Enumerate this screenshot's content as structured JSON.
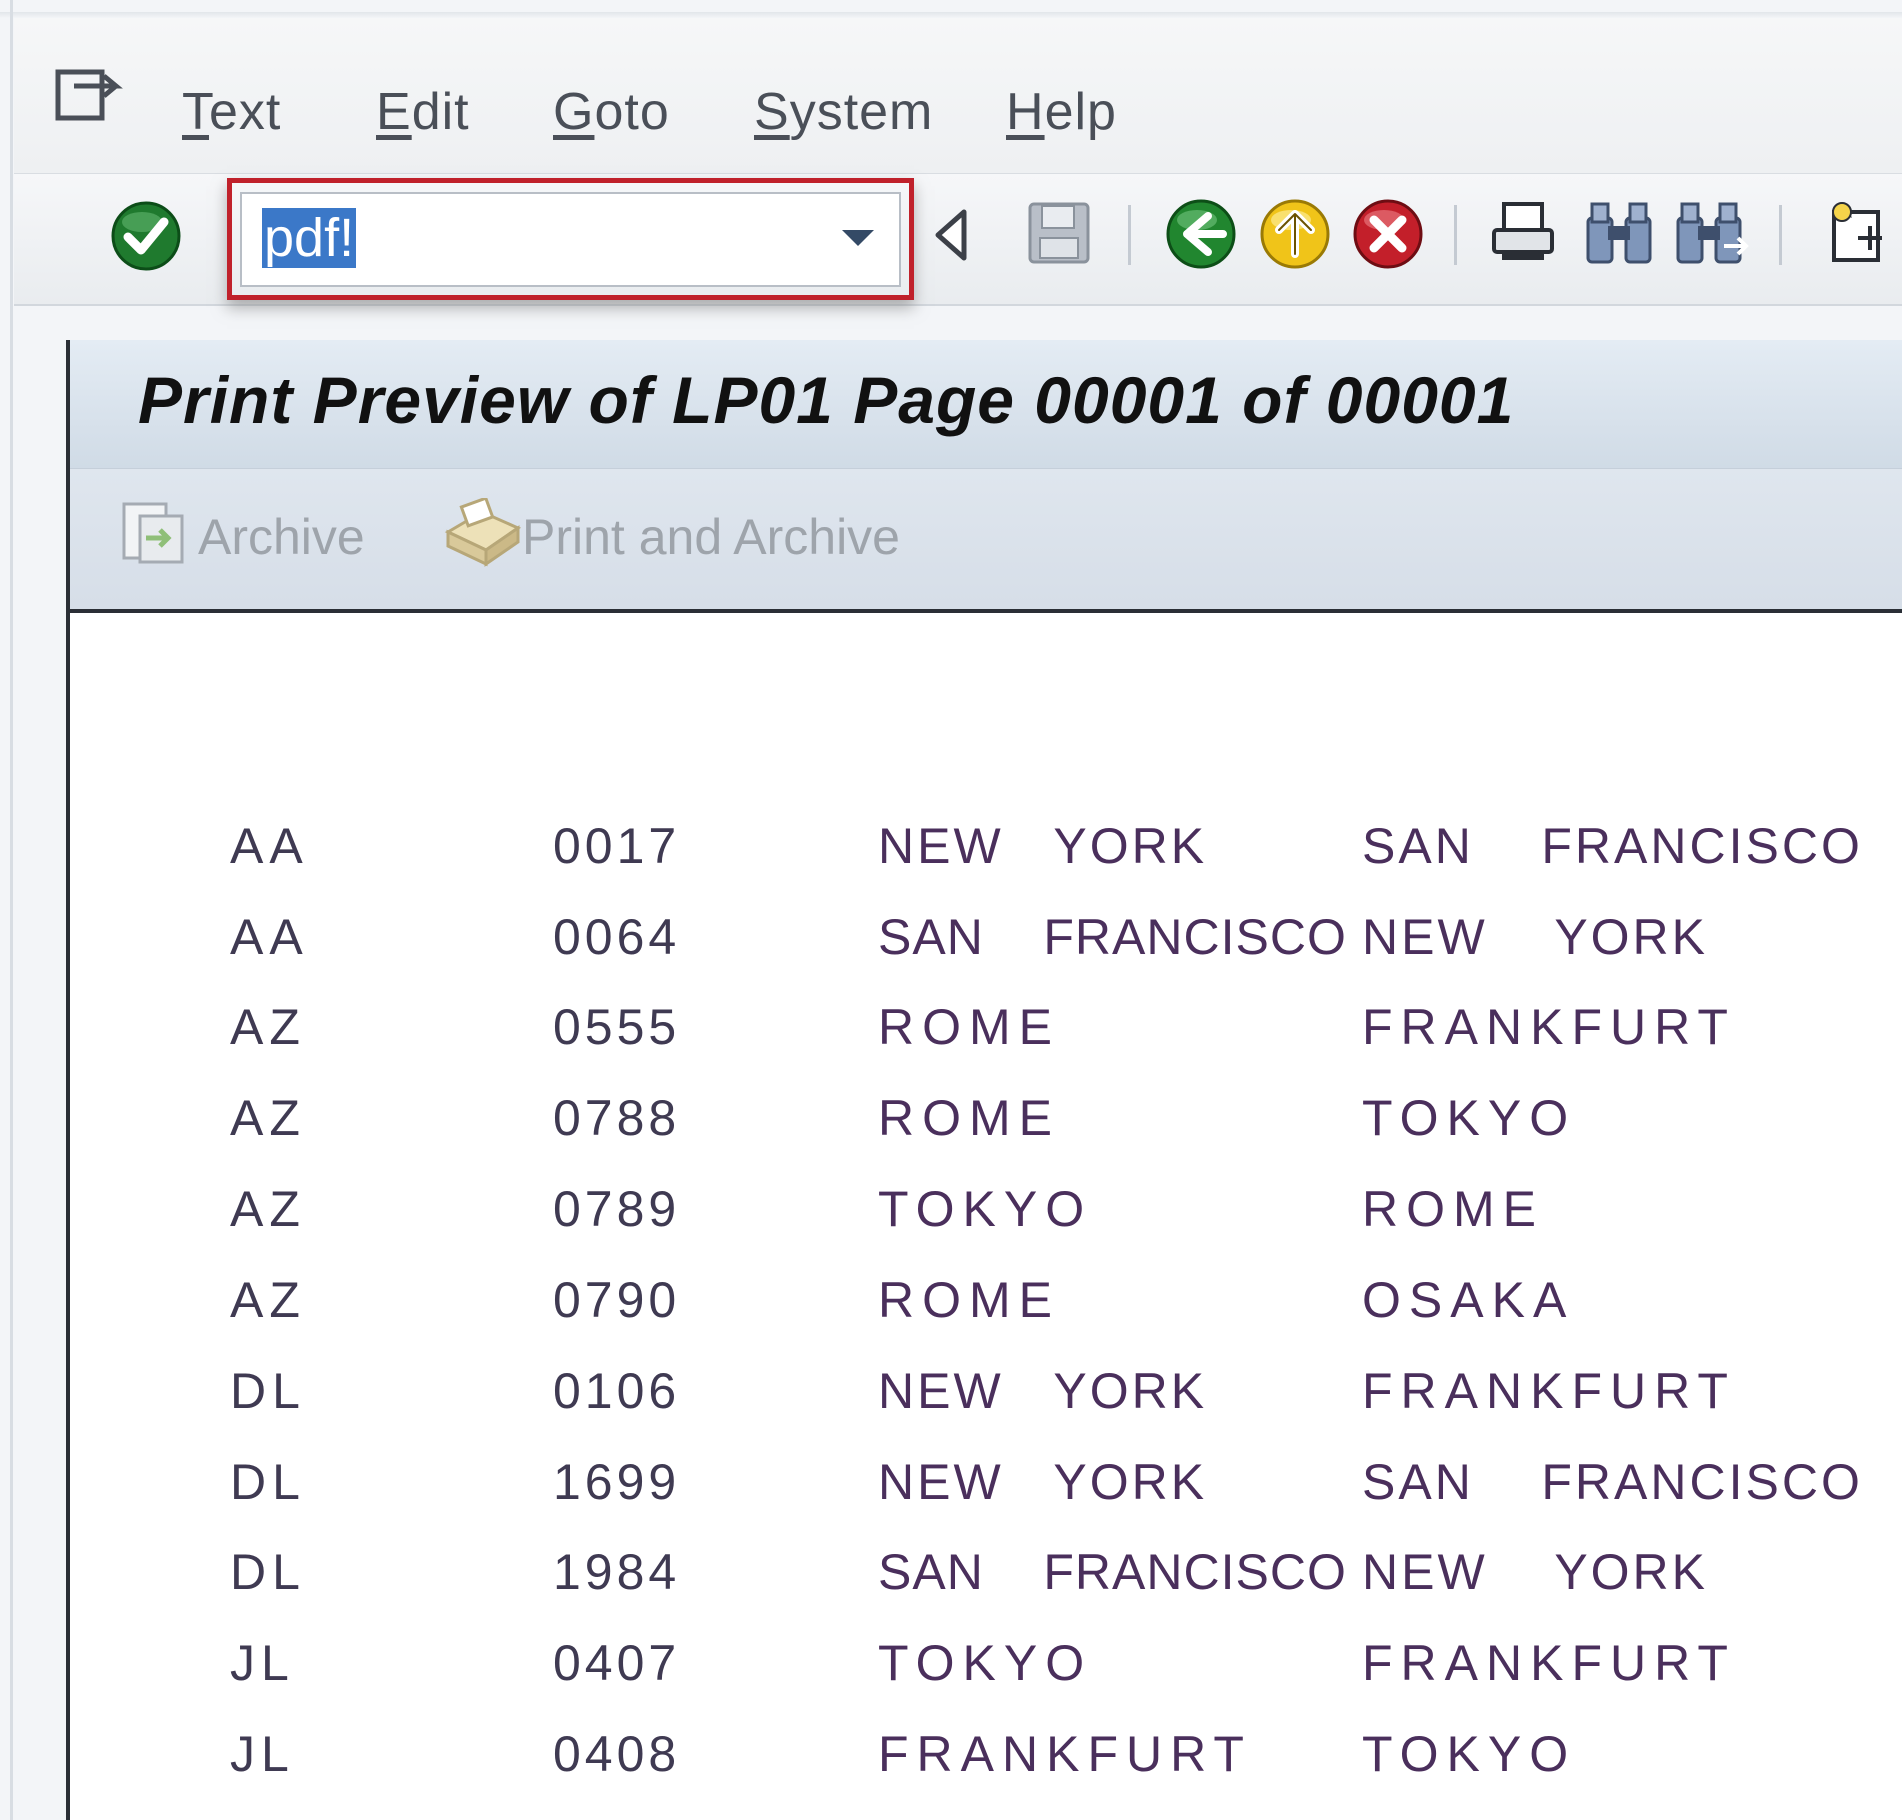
{
  "menubar": {
    "items": [
      {
        "label": "Text",
        "u": "T",
        "rest": "ext"
      },
      {
        "label": "Edit",
        "u": "E",
        "rest": "dit"
      },
      {
        "label": "Goto",
        "u": "G",
        "rest": "oto"
      },
      {
        "label": "System",
        "u": "S",
        "rest": "ystem"
      },
      {
        "label": "Help",
        "u": "H",
        "rest": "elp"
      }
    ]
  },
  "toolbar": {
    "command_value": "pdf!",
    "icons": [
      "enter-checkmark-icon",
      "command-dropdown-icon",
      "collapse-command-icon",
      "save-icon",
      "back-icon",
      "exit-icon",
      "cancel-icon",
      "print-icon",
      "find-icon",
      "find-next-icon",
      "create-session-icon"
    ]
  },
  "title": "Print Preview of LP01 Page 00001 of 00001",
  "app_toolbar": {
    "archive_label": "Archive",
    "print_archive_label": "Print and Archive"
  },
  "rows": [
    {
      "airline": "AA",
      "conn": "0017",
      "from": "NEW   YORK",
      "to": "SAN    FRANCISCO"
    },
    {
      "airline": "AA",
      "conn": "0064",
      "from": "SAN    FRANCISCO",
      "to": "NEW    YORK"
    },
    {
      "airline": "AZ",
      "conn": "0555",
      "from": "ROME",
      "to": "FRANKFURT"
    },
    {
      "airline": "AZ",
      "conn": "0788",
      "from": "ROME",
      "to": "TOKYO"
    },
    {
      "airline": "AZ",
      "conn": "0789",
      "from": "TOKYO",
      "to": "ROME"
    },
    {
      "airline": "AZ",
      "conn": "0790",
      "from": "ROME",
      "to": "OSAKA"
    },
    {
      "airline": "DL",
      "conn": "0106",
      "from": "NEW   YORK",
      "to": "FRANKFURT"
    },
    {
      "airline": "DL",
      "conn": "1699",
      "from": "NEW   YORK",
      "to": "SAN    FRANCISCO"
    },
    {
      "airline": "DL",
      "conn": "1984",
      "from": "SAN    FRANCISCO",
      "to": "NEW    YORK"
    },
    {
      "airline": "JL",
      "conn": "0407",
      "from": "TOKYO",
      "to": "FRANKFURT"
    },
    {
      "airline": "JL",
      "conn": "0408",
      "from": "FRANKFURT",
      "to": "TOKYO"
    }
  ],
  "colors": {
    "highlight_border": "#c0212b",
    "selection": "#3b78c8",
    "title_bar": "#d8e2ec"
  }
}
